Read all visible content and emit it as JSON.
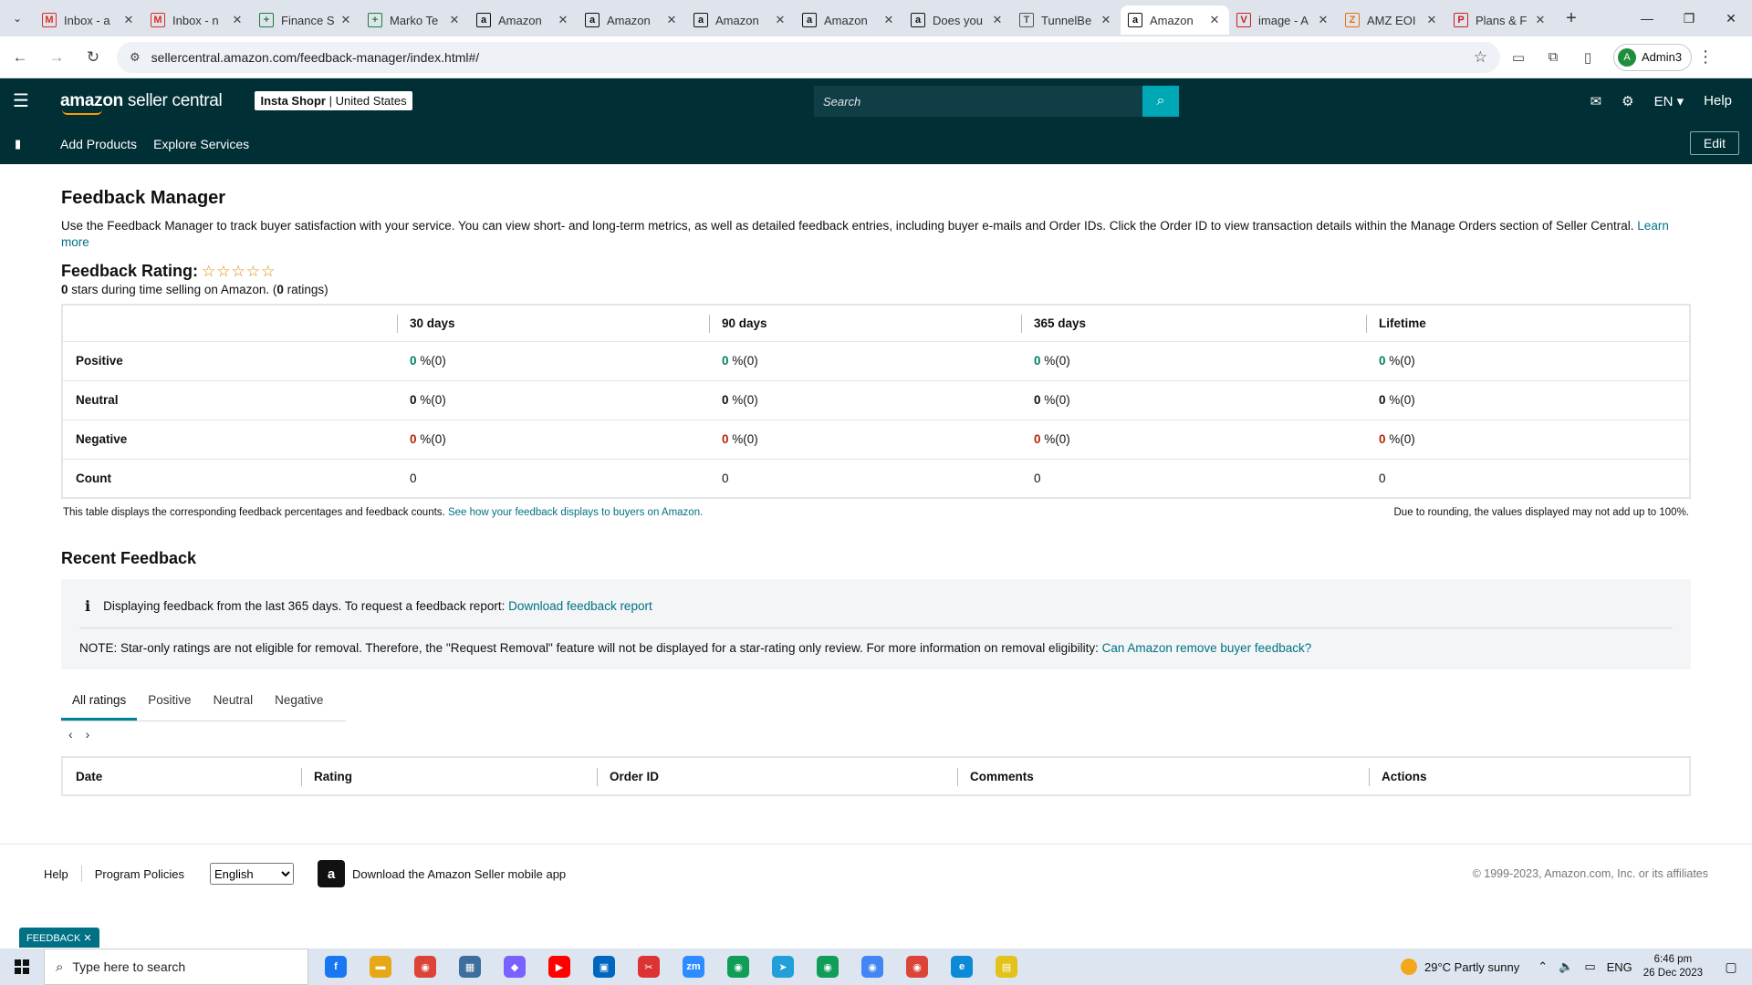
{
  "browser": {
    "tabs": [
      {
        "label": "Inbox - a",
        "icon": "gmail-icon",
        "glyph": "M",
        "color": "#d93025",
        "active": false
      },
      {
        "label": "Inbox - n",
        "icon": "gmail-icon",
        "glyph": "M",
        "color": "#d93025",
        "active": false
      },
      {
        "label": "Finance S",
        "icon": "sheets-icon",
        "glyph": "+",
        "color": "#188038",
        "active": false
      },
      {
        "label": "Marko Te",
        "icon": "sheets-icon",
        "glyph": "+",
        "color": "#188038",
        "active": false
      },
      {
        "label": "Amazon",
        "icon": "amazon-icon",
        "glyph": "a",
        "color": "#111111",
        "active": false
      },
      {
        "label": "Amazon",
        "icon": "amazon-icon",
        "glyph": "a",
        "color": "#111111",
        "active": false
      },
      {
        "label": "Amazon",
        "icon": "amazon-icon",
        "glyph": "a",
        "color": "#111111",
        "active": false
      },
      {
        "label": "Amazon",
        "icon": "amazon-icon",
        "glyph": "a",
        "color": "#111111",
        "active": false
      },
      {
        "label": "Does you",
        "icon": "amazon-icon",
        "glyph": "a",
        "color": "#111111",
        "active": false
      },
      {
        "label": "TunnelBe",
        "icon": "tunnel-icon",
        "glyph": "T",
        "color": "#555555",
        "active": false
      },
      {
        "label": "Amazon",
        "icon": "amazon-icon",
        "glyph": "a",
        "color": "#111111",
        "active": true
      },
      {
        "label": "image - A",
        "icon": "image-icon",
        "glyph": "V",
        "color": "#c5221f",
        "active": false
      },
      {
        "label": "AMZ EOI",
        "icon": "amz-icon",
        "glyph": "Z",
        "color": "#e8710a",
        "active": false
      },
      {
        "label": "Plans & F",
        "icon": "plans-icon",
        "glyph": "P",
        "color": "#c5221f",
        "active": false
      }
    ],
    "url": "sellercentral.amazon.com/feedback-manager/index.html#/",
    "profile": "Admin3",
    "profile_initial": "A"
  },
  "header": {
    "logo_bold": "amazon",
    "logo_rest": " seller central",
    "store_name": "Insta Shopr",
    "store_region": "United States",
    "search_placeholder": "Search",
    "lang": "EN ▾",
    "help": "Help"
  },
  "subnav": {
    "add_products": "Add Products",
    "explore_services": "Explore Services",
    "edit": "Edit"
  },
  "page": {
    "title": "Feedback Manager",
    "intro": "Use the Feedback Manager to track buyer satisfaction with your service. You can view short- and long-term metrics, as well as detailed feedback entries, including buyer e-mails and Order IDs. Click the Order ID to view transaction details within the Manage Orders section of Seller Central. ",
    "learn_more": "Learn more",
    "rating_title": "Feedback Rating:",
    "rating_stars": "☆☆☆☆☆",
    "rating_value": 0,
    "rating_sub_a": "0",
    "rating_sub_b": " stars during time selling on Amazon. (",
    "rating_sub_c": "0",
    "rating_sub_d": " ratings)"
  },
  "metrics": {
    "columns": [
      "30 days",
      "90 days",
      "365 days",
      "Lifetime"
    ],
    "rows": [
      {
        "label": "Positive",
        "kind": "pos",
        "values": [
          "0",
          "0",
          "0",
          "0"
        ],
        "counts": [
          "(0)",
          "(0)",
          "(0)",
          "(0)"
        ]
      },
      {
        "label": "Neutral",
        "kind": "neu",
        "values": [
          "0",
          "0",
          "0",
          "0"
        ],
        "counts": [
          "(0)",
          "(0)",
          "(0)",
          "(0)"
        ]
      },
      {
        "label": "Negative",
        "kind": "neg",
        "values": [
          "0",
          "0",
          "0",
          "0"
        ],
        "counts": [
          "(0)",
          "(0)",
          "(0)",
          "(0)"
        ]
      }
    ],
    "count_label": "Count",
    "counts": [
      "0",
      "0",
      "0",
      "0"
    ],
    "percent_sign": " %",
    "note_left": "This table displays the corresponding feedback percentages and feedback counts. ",
    "note_link": "See how your feedback displays to buyers on Amazon.",
    "note_right": "Due to rounding, the values displayed may not add up to 100%."
  },
  "recent": {
    "title": "Recent Feedback",
    "info_icon": "i",
    "info_text": "Displaying feedback from the last 365 days. To request a feedback report: ",
    "info_link": "Download feedback report",
    "note_text": "NOTE: Star-only ratings are not eligible for removal. Therefore, the \"Request Removal\" feature will not be displayed for a star-rating only review. For more information on removal eligibility: ",
    "note_link": "Can Amazon remove buyer feedback?",
    "tabs": [
      "All ratings",
      "Positive",
      "Neutral",
      "Negative"
    ],
    "prev": "‹",
    "next": "›",
    "columns": [
      "Date",
      "Rating",
      "Order ID",
      "Comments",
      "Actions"
    ]
  },
  "footer": {
    "help": "Help",
    "policies": "Program Policies",
    "language": "English",
    "app_text": "Download the Amazon Seller mobile app",
    "copyright": "© 1999-2023, Amazon.com, Inc. or its affiliates",
    "feedback_tab": "FEEDBACK ✕"
  },
  "taskbar": {
    "search_placeholder": "Type here to search",
    "weather": "29°C  Partly sunny",
    "lang": "ENG",
    "time": "6:46 pm",
    "date": "26 Dec 2023",
    "apps": [
      {
        "name": "facebook-icon",
        "glyph": "f",
        "color": "#1877f2"
      },
      {
        "name": "file-explorer-icon",
        "glyph": "▬",
        "color": "#e6a817"
      },
      {
        "name": "chrome-icon",
        "glyph": "◉",
        "color": "#db4437"
      },
      {
        "name": "calculator-icon",
        "glyph": "▦",
        "color": "#3c6e9e"
      },
      {
        "name": "copilot-icon",
        "glyph": "◆",
        "color": "#7b61ff"
      },
      {
        "name": "youtube-icon",
        "glyph": "▶",
        "color": "#ff0000"
      },
      {
        "name": "store-icon",
        "glyph": "▣",
        "color": "#0067c0"
      },
      {
        "name": "snipping-icon",
        "glyph": "✂",
        "color": "#d33"
      },
      {
        "name": "zoom-icon",
        "glyph": "zm",
        "color": "#2d8cff"
      },
      {
        "name": "chrome-profile-icon",
        "glyph": "◉",
        "color": "#0f9d58"
      },
      {
        "name": "telegram-icon",
        "glyph": "➤",
        "color": "#229ed9"
      },
      {
        "name": "chrome-profile-icon",
        "glyph": "◉",
        "color": "#0f9d58"
      },
      {
        "name": "chrome-profile-icon",
        "glyph": "◉",
        "color": "#4285f4"
      },
      {
        "name": "chrome-profile-icon",
        "glyph": "◉",
        "color": "#db4437"
      },
      {
        "name": "edge-icon",
        "glyph": "e",
        "color": "#0c8ad6"
      },
      {
        "name": "sticky-notes-icon",
        "glyph": "▤",
        "color": "#e3c21a"
      }
    ]
  }
}
